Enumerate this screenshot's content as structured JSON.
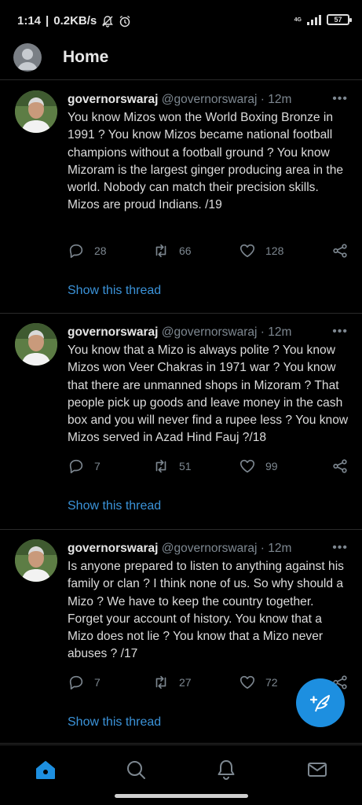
{
  "status_bar": {
    "time": "1:14",
    "speed": "0.2KB/s",
    "network": "4G",
    "battery": "57"
  },
  "header": {
    "title": "Home"
  },
  "tweets": [
    {
      "name": "governorswaraj",
      "handle": "@governorswaraj",
      "time": "12m",
      "text": "You know Mizos won the World Boxing Bronze in 1991 ? You know Mizos became national football champions without a football ground ? You know Mizoram is the largest ginger producing area in the world. Nobody can match their precision skills.\nMizos are proud Indians. /19",
      "replies": "28",
      "retweets": "66",
      "likes": "128",
      "show_thread": "Show this thread"
    },
    {
      "name": "governorswaraj",
      "handle": "@governorswaraj",
      "time": "12m",
      "text": "You know that a Mizo is always polite ? You know Mizos won Veer Chakras in 1971 war ? You know that there are unmanned shops in Mizoram ? That people pick up goods and leave money in the cash box and you will never find a rupee less ? You know Mizos served in Azad Hind Fauj ?/18",
      "replies": "7",
      "retweets": "51",
      "likes": "99",
      "show_thread": "Show this thread"
    },
    {
      "name": "governorswaraj",
      "handle": "@governorswaraj",
      "time": "12m",
      "text": "Is anyone prepared to listen to anything against his family or clan ? I think none of us. So why should a Mizo ? We have to keep the country together. Forget your account of history. You know that a Mizo does not lie ? You know that a Mizo never abuses ? /17",
      "replies": "7",
      "retweets": "27",
      "likes": "72",
      "show_thread": "Show this thread"
    }
  ],
  "icons": {
    "reply": "reply-icon",
    "retweet": "retweet-icon",
    "like": "heart-icon",
    "share": "share-icon",
    "more": "more-icon",
    "compose": "compose-tweet-icon",
    "nav": [
      "home-icon",
      "search-icon",
      "notifications-icon",
      "messages-icon"
    ]
  },
  "colors": {
    "accent": "#1d8fe0",
    "link": "#3b93d9",
    "muted": "#7d8790",
    "background": "#000000"
  }
}
